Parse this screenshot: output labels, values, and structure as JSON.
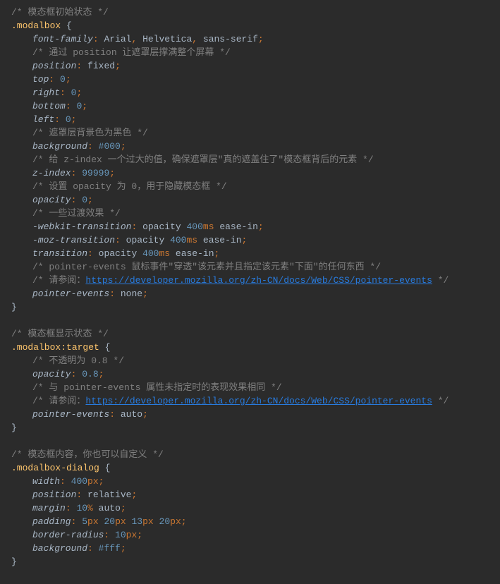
{
  "code": {
    "comment_initial": "/* 模态框初始状态 */",
    "sel_modalbox": ".modalbox",
    "brace_open": "{",
    "brace_close": "}",
    "ff_prop": "font-family",
    "ff_val": "Arial, Helvetica, sans-serif",
    "comment_position": "/* 通过 position 让遮罩层撑满整个屏幕 */",
    "pos_prop": "position",
    "pos_val": "fixed",
    "top_prop": "top",
    "zero": "0",
    "right_prop": "right",
    "bottom_prop": "bottom",
    "left_prop": "left",
    "comment_bg": "/* 遮罩层背景色为黑色 */",
    "bg_prop": "background",
    "bg_val": "#000",
    "comment_zindex": "/* 给 z-index 一个过大的值，确保遮罩层\"真的遮盖住了\"模态框背后的元素 */",
    "zindex_prop": "z-index",
    "zindex_val": "99999",
    "comment_opacity": "/* 设置 opacity 为 0，用于隐藏模态框 */",
    "opacity_prop": "opacity",
    "comment_trans": "/* 一些过渡效果 */",
    "webkit_trans_prop": "-webkit-transition",
    "trans_val_opacity": "opacity",
    "trans_400": "400",
    "ms": "ms",
    "ease_in": "ease-in",
    "moz_trans_prop": "-moz-transition",
    "trans_prop": "transition",
    "comment_pe1": "/* pointer-events 鼠标事件\"穿透\"该元素并且指定该元素\"下面\"的任何东西 */",
    "comment_see": "/* 请参阅：",
    "url_pe": "https://developer.mozilla.org/zh-CN/docs/Web/CSS/pointer-events",
    "comment_end": " */",
    "pe_prop": "pointer-events",
    "pe_none": "none",
    "comment_display": "/* 模态框显示状态 */",
    "sel_target": ".modalbox:target",
    "comment_op08": "/* 不透明为 0.8 */",
    "op08": "0",
    "op08_dec": ".8",
    "comment_pe_unset": "/* 与 pointer-events 属性未指定时的表现效果相同 */",
    "pe_auto": "auto",
    "comment_content": "/* 模态框内容，你也可以自定义 */",
    "sel_dialog": ".modalbox-dialog",
    "width_prop": "width",
    "w400": "400",
    "px": "px",
    "pos_rel": "relative",
    "margin_prop": "margin",
    "m10": "10",
    "pct": "%",
    "auto": "auto",
    "padding_prop": "padding",
    "p5": "5",
    "p20": "20",
    "p13": "13",
    "br_prop": "border-radius",
    "br10": "10",
    "bg_fff": "#fff",
    "semi": ";",
    "colon": ":",
    "sp": " ",
    "comma": ","
  }
}
